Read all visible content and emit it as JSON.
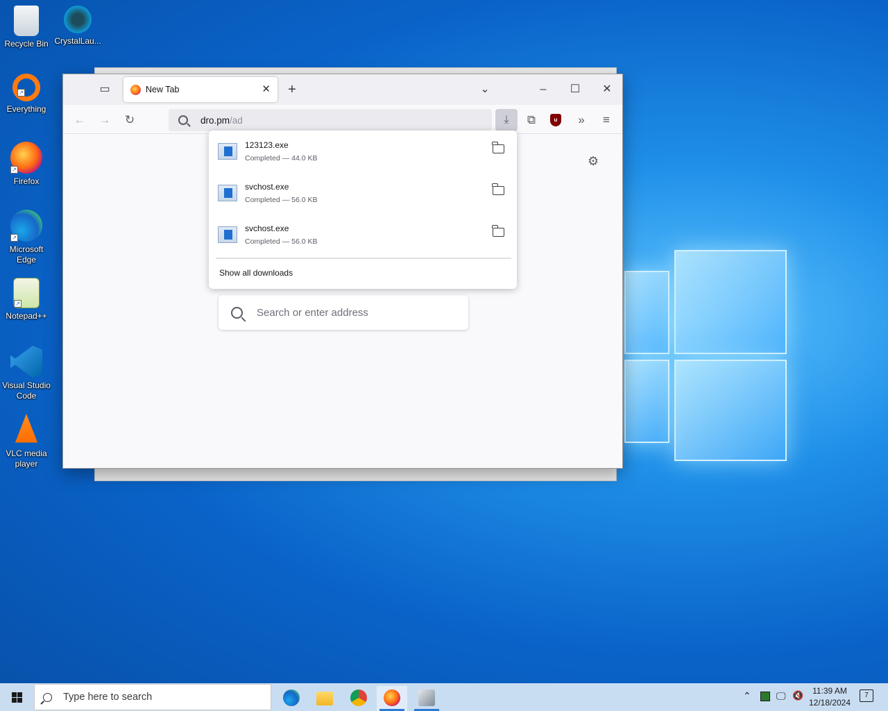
{
  "desktop": {
    "icons": [
      {
        "label": "Recycle Bin"
      },
      {
        "label": "CrystalLau..."
      },
      {
        "label": "Everything"
      },
      {
        "label": "Firefox"
      },
      {
        "label": "Microsoft Edge"
      },
      {
        "label": "Notepad++"
      },
      {
        "label": "Visual Studio Code"
      },
      {
        "label": "VLC media player"
      }
    ]
  },
  "browser": {
    "tab": {
      "title": "New Tab"
    },
    "url": {
      "host": "dro.pm",
      "path": "/ad"
    },
    "newtab": {
      "search_placeholder": "Search or enter address"
    },
    "downloads": {
      "items": [
        {
          "name": "123123.exe",
          "status": "Completed — 44.0 KB"
        },
        {
          "name": "svchost.exe",
          "status": "Completed — 56.0 KB"
        },
        {
          "name": "svchost.exe",
          "status": "Completed — 56.0 KB"
        }
      ],
      "show_all": "Show all downloads"
    }
  },
  "taskbar": {
    "search_placeholder": "Type here to search",
    "clock_time": "11:39 AM",
    "clock_date": "12/18/2024",
    "notification_count": "7"
  }
}
